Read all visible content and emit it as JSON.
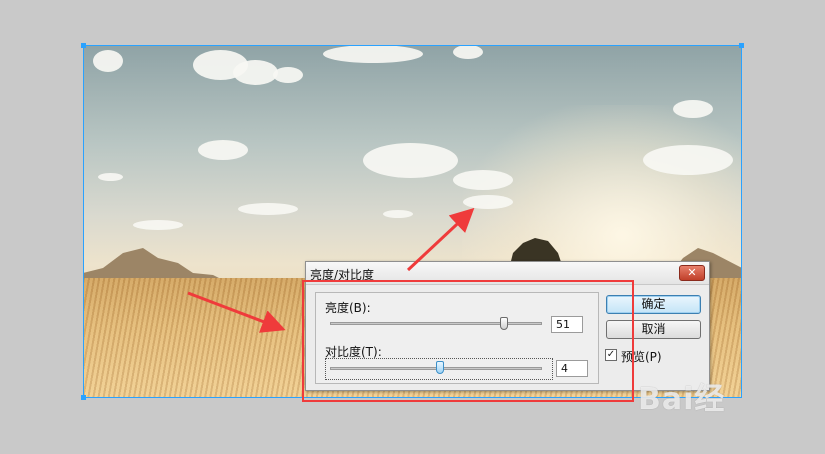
{
  "dialog": {
    "title": "亮度/对比度",
    "close_label": "✕",
    "brightness": {
      "label": "亮度(B):",
      "value": "51",
      "fraction": 0.82
    },
    "contrast": {
      "label": "对比度(T):",
      "value": "4",
      "fraction": 0.52
    },
    "ok_label": "确定",
    "cancel_label": "取消",
    "preview_label": "预览(P)",
    "preview_checked": true
  },
  "colors": {
    "annotation_red": "#ef3b3b",
    "selection_blue": "#2aa2ff"
  },
  "watermark": {
    "text": "Bai经"
  }
}
